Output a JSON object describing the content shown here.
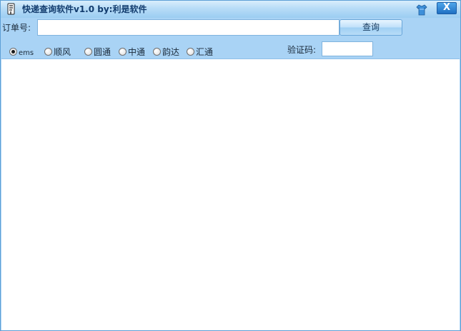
{
  "window": {
    "title": "快递查询软件v1.0  by:利是软件",
    "close_label": "X"
  },
  "order": {
    "label": "订单号:",
    "value": "",
    "query_label": "查询"
  },
  "carriers": [
    {
      "label": "ems",
      "checked": true
    },
    {
      "label": "顺风",
      "checked": false
    },
    {
      "label": "圆通",
      "checked": false
    },
    {
      "label": "中通",
      "checked": false
    },
    {
      "label": "韵达",
      "checked": false
    },
    {
      "label": "汇通",
      "checked": false
    }
  ],
  "captcha": {
    "label": "验证码:",
    "value": ""
  },
  "colors": {
    "window_bg": "#a9d3f5",
    "title_text": "#123c6e",
    "close_button": "#1f6fc2",
    "result_bg": "#ffffff"
  },
  "icons": {
    "app": "app-icon",
    "skin": "skin-icon",
    "close": "close-icon"
  }
}
